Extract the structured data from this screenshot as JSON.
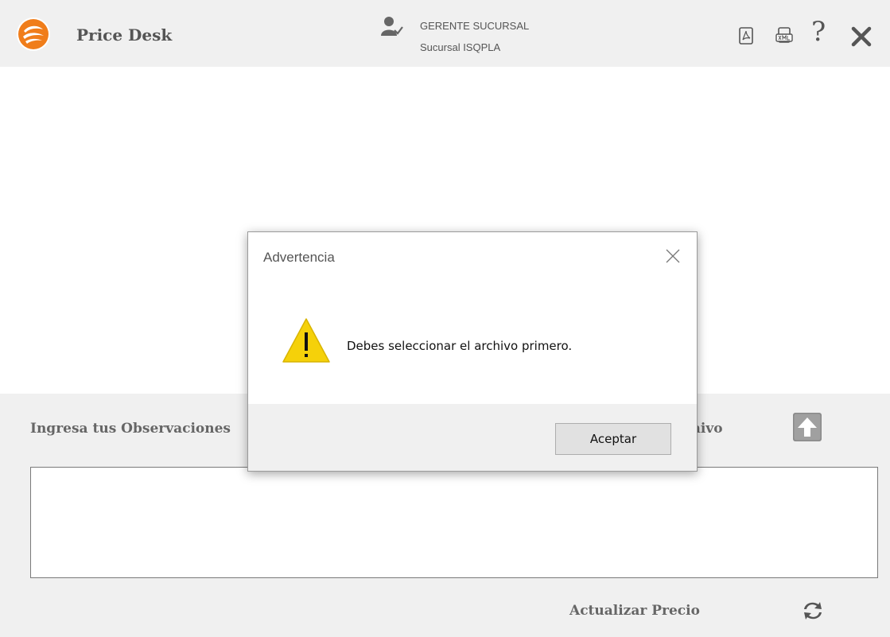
{
  "header": {
    "app_title": "Price Desk",
    "user_role": "GERENTE SUCURSAL",
    "user_branch": "Sucursal ISQPLA",
    "help_label": "?",
    "icons": {
      "logo": "price-desk-logo",
      "user": "user-check-icon",
      "pdf": "pdf-icon",
      "xml": "xml-icon",
      "help": "help-icon",
      "close": "close-icon"
    },
    "logo_color": "#f07d1a"
  },
  "main": {
    "observations_label": "Ingresa tus Observaciones",
    "file_label": "Archivo",
    "update_price_label": "Actualizar Precio",
    "observations_value": ""
  },
  "dialog": {
    "title": "Advertencia",
    "message": "Debes seleccionar el archivo primero.",
    "accept_label": "Aceptar",
    "warning_color": "#f5d10a"
  }
}
